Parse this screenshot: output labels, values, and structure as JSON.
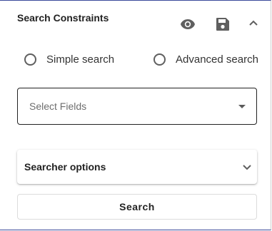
{
  "header": {
    "title": "Search Constraints",
    "icons": [
      "eye-icon",
      "save-icon",
      "chevron-up-icon"
    ]
  },
  "search_mode": {
    "options": [
      {
        "label": "Simple search",
        "selected": false
      },
      {
        "label": "Advanced search",
        "selected": false
      }
    ]
  },
  "fields_select": {
    "placeholder": "Select Fields"
  },
  "searcher_options": {
    "label": "Searcher options",
    "expanded": false
  },
  "actions": {
    "search_label": "Search"
  },
  "colors": {
    "icon": "#5f5f5f",
    "border_accent": "#3b4a9a"
  }
}
